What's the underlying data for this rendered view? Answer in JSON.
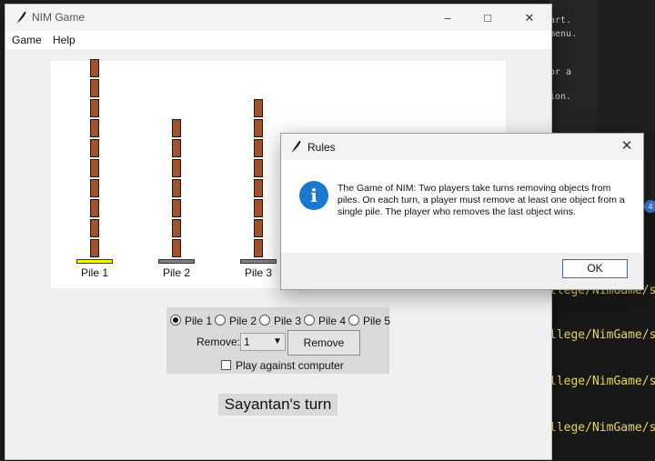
{
  "background": {
    "code_lines": [
      "art.",
      "menu.",
      "",
      "or a",
      "ion."
    ],
    "terminal_paths": [
      "llege/NimGame/sr",
      "llege/NimGame/sr",
      "llege/NimGame/sr",
      "llege/NimGame/sr"
    ],
    "badge": "4"
  },
  "window": {
    "title": "NIM Game",
    "menu": [
      "Game",
      "Help"
    ]
  },
  "piles": [
    {
      "label": "Pile 1",
      "count": 10,
      "selected": true
    },
    {
      "label": "Pile 2",
      "count": 7,
      "selected": false
    },
    {
      "label": "Pile 3",
      "count": 8,
      "selected": false
    }
  ],
  "controls": {
    "pile_options": [
      "Pile 1",
      "Pile 2",
      "Pile 3",
      "Pile 4",
      "Pile 5"
    ],
    "selected_pile": "Pile 1",
    "remove_label": "Remove:",
    "remove_value": "1",
    "remove_button": "Remove",
    "computer_checkbox": "Play against computer",
    "computer_checked": false
  },
  "status": {
    "turn_text": "Sayantan's turn"
  },
  "dialog": {
    "title": "Rules",
    "message": "The Game of NIM: Two players take turns removing objects from piles. On each turn, a player must remove at least one object from a single pile. The player who removes the last object wins.",
    "ok": "OK"
  },
  "colors": {
    "brick": "#a0522d",
    "selected_base": "#ffff00",
    "base": "#808080",
    "info": "#1a78d0"
  }
}
